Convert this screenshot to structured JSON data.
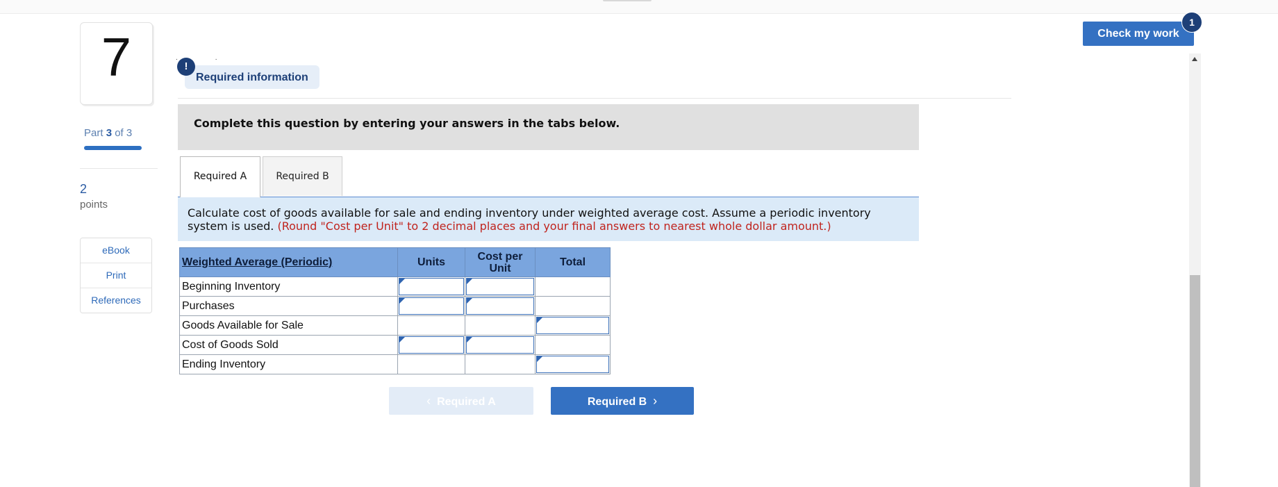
{
  "question": {
    "number": "7",
    "part_label": "Part",
    "part_current": "3",
    "part_of": "of 3",
    "points_value": "2",
    "points_label": "points"
  },
  "sidebar": {
    "links": [
      {
        "label": "eBook"
      },
      {
        "label": "Print"
      },
      {
        "label": "References"
      }
    ]
  },
  "header": {
    "dots": "..",
    "alert_icon": "!",
    "required_info": "Required information",
    "check_work": "Check my work",
    "check_badge": "1"
  },
  "instructions": "Complete this question by entering your answers in the tabs below.",
  "tabs": [
    {
      "label": "Required A",
      "active": true
    },
    {
      "label": "Required B",
      "active": false
    }
  ],
  "description": {
    "text": "Calculate cost of goods available for sale and ending inventory under weighted average cost. Assume a periodic inventory system is used.",
    "note": "(Round \"Cost per Unit\" to 2 decimal places and your final answers to nearest whole dollar amount.)"
  },
  "table": {
    "headers": [
      "Weighted Average (Periodic)",
      "Units",
      "Cost per Unit",
      "Total"
    ],
    "rows": [
      {
        "label": "Beginning Inventory",
        "units": "",
        "cost": "",
        "total": ""
      },
      {
        "label": "Purchases",
        "units": "",
        "cost": "",
        "total": ""
      },
      {
        "label": "Goods Available for Sale",
        "units": "",
        "cost": "",
        "total": ""
      },
      {
        "label": "Cost of Goods Sold",
        "units": "",
        "cost": "",
        "total": ""
      },
      {
        "label": "Ending Inventory",
        "units": "",
        "cost": "",
        "total": ""
      }
    ]
  },
  "nav": {
    "prev_label": "Required A",
    "next_label": "Required B",
    "prev_icon": "chevron-left-icon",
    "next_icon": "chevron-right-icon"
  },
  "colors": {
    "primary": "#3471c2",
    "dark_navy": "#1d3f77",
    "table_header": "#7aa5de",
    "description_bg": "#dbeaf8",
    "note_red": "#c0241e"
  }
}
